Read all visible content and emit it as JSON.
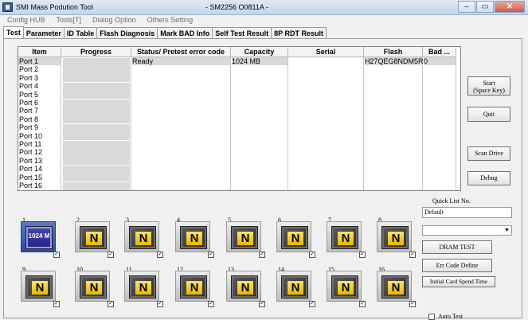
{
  "window": {
    "title": "SMI Mass Podution Tool",
    "subtitle": "- SM2256 O0811A -",
    "minimize": "–",
    "maximize": "▭",
    "close": "✕"
  },
  "menu": [
    "Config HUB",
    "Tools[T]",
    "Dialog Option",
    "Others Setting"
  ],
  "tabs": [
    "Test",
    "Parameter",
    "ID Table",
    "Flash Diagnosis",
    "Mark BAD Info",
    "Self Test Result",
    "8P RDT Result"
  ],
  "table": {
    "headers": [
      "Item",
      "Progress",
      "Status/ Pretest error code",
      "Capacity",
      "Serial",
      "Flash",
      "Bad ..."
    ],
    "rows": [
      {
        "item": "Port 1",
        "status": "Ready",
        "capacity": "1024 MB",
        "serial": "",
        "flash": "H27QEG8NDM5R",
        "bad": "0"
      },
      {
        "item": "Port 2",
        "status": "",
        "capacity": "",
        "serial": "",
        "flash": "",
        "bad": ""
      },
      {
        "item": "Port 3",
        "status": "",
        "capacity": "",
        "serial": "",
        "flash": "",
        "bad": ""
      },
      {
        "item": "Port 4",
        "status": "",
        "capacity": "",
        "serial": "",
        "flash": "",
        "bad": ""
      },
      {
        "item": "Port 5",
        "status": "",
        "capacity": "",
        "serial": "",
        "flash": "",
        "bad": ""
      },
      {
        "item": "Port 6",
        "status": "",
        "capacity": "",
        "serial": "",
        "flash": "",
        "bad": ""
      },
      {
        "item": "Port 7",
        "status": "",
        "capacity": "",
        "serial": "",
        "flash": "",
        "bad": ""
      },
      {
        "item": "Port 8",
        "status": "",
        "capacity": "",
        "serial": "",
        "flash": "",
        "bad": ""
      },
      {
        "item": "Port 9",
        "status": "",
        "capacity": "",
        "serial": "",
        "flash": "",
        "bad": ""
      },
      {
        "item": "Port 10",
        "status": "",
        "capacity": "",
        "serial": "",
        "flash": "",
        "bad": ""
      },
      {
        "item": "Port 11",
        "status": "",
        "capacity": "",
        "serial": "",
        "flash": "",
        "bad": ""
      },
      {
        "item": "Port 12",
        "status": "",
        "capacity": "",
        "serial": "",
        "flash": "",
        "bad": ""
      },
      {
        "item": "Port 13",
        "status": "",
        "capacity": "",
        "serial": "",
        "flash": "",
        "bad": ""
      },
      {
        "item": "Port 14",
        "status": "",
        "capacity": "",
        "serial": "",
        "flash": "",
        "bad": ""
      },
      {
        "item": "Port 15",
        "status": "",
        "capacity": "",
        "serial": "",
        "flash": "",
        "bad": ""
      },
      {
        "item": "Port 16",
        "status": "",
        "capacity": "",
        "serial": "",
        "flash": "",
        "bad": ""
      }
    ]
  },
  "buttons": {
    "start_line1": "Start",
    "start_line2": "(Space Key)",
    "quit": "Quit",
    "scan_drive": "Scan Drive",
    "debug": "Debug",
    "dram_test": "DRAM TEST",
    "err_code_define": "Err Code Define",
    "initial_card_spend_time": "Initial Card Spend Time"
  },
  "quick_list": {
    "label": "Quick List No.",
    "value": "Default",
    "select_value": ""
  },
  "slots": [
    {
      "num": "1",
      "caption": "1024 M",
      "active": true
    },
    {
      "num": "2",
      "caption": "N"
    },
    {
      "num": "3",
      "caption": "N"
    },
    {
      "num": "4",
      "caption": "N"
    },
    {
      "num": "5",
      "caption": "N"
    },
    {
      "num": "6",
      "caption": "N"
    },
    {
      "num": "7",
      "caption": "N"
    },
    {
      "num": "8",
      "caption": "N"
    },
    {
      "num": "9",
      "caption": "N"
    },
    {
      "num": "10",
      "caption": "N"
    },
    {
      "num": "11",
      "caption": "N"
    },
    {
      "num": "12",
      "caption": "N"
    },
    {
      "num": "13",
      "caption": "N"
    },
    {
      "num": "14",
      "caption": "N"
    },
    {
      "num": "15",
      "caption": "N"
    },
    {
      "num": "16",
      "caption": "N"
    }
  ],
  "auto_test": "Auto Test",
  "check_mark": "✓"
}
